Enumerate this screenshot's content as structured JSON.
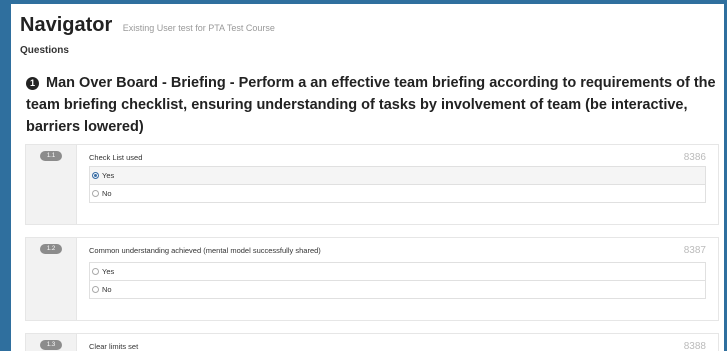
{
  "header": {
    "title": "Navigator",
    "subtitle": "Existing User test for PTA Test Course"
  },
  "section_label": "Questions",
  "question": {
    "number_icon": "1",
    "text": "Man Over Board - Briefing - Perform a an effective team briefing according to requirements of the team briefing checklist, ensuring understanding of tasks by involvement of team (be interactive, barriers lowered)"
  },
  "items": [
    {
      "num": "1.1",
      "label": "Check List used",
      "code": "8386",
      "options": [
        {
          "label": "Yes",
          "selected": true
        },
        {
          "label": "No",
          "selected": false
        }
      ]
    },
    {
      "num": "1.2",
      "label": "Common understanding achieved (mental model successfully shared)",
      "code": "8387",
      "options": [
        {
          "label": "Yes",
          "selected": false
        },
        {
          "label": "No",
          "selected": false
        }
      ]
    },
    {
      "num": "1.3",
      "label": "Clear limits set",
      "code": "8388",
      "options": []
    }
  ]
}
